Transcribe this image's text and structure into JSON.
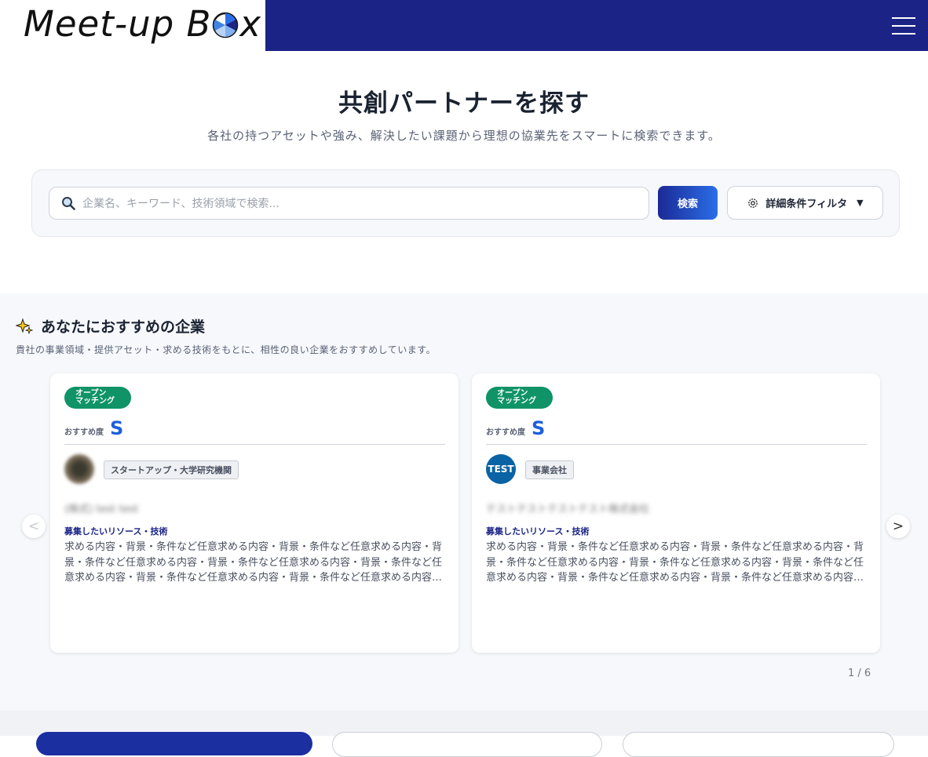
{
  "header": {
    "logo_text_main": "Meet-up B",
    "logo_text_tail": "x",
    "menu_icon": "hamburger-icon"
  },
  "hero": {
    "title": "共創パートナーを探す",
    "subtitle": "各社の持つアセットや強み、解決したい課題から理想の協業先をスマートに検索できます。"
  },
  "search": {
    "placeholder": "企業名、キーワード、技術領域で検索...",
    "value": "",
    "button_label": "検索",
    "filter_label": "詳細条件フィルタ",
    "filter_caret": "▼"
  },
  "recommend": {
    "title": "あなたにおすすめの企業",
    "subtitle": "貴社の事業領域・提供アセット・求める技術をもとに、相性の良い企業をおすすめしています。",
    "prev_arrow": "<",
    "next_arrow": ">",
    "pager": "1 / 6",
    "cards": [
      {
        "badge_line1": "オープン",
        "badge_line2": "マッチング",
        "score_label": "おすすめ度",
        "score": "S",
        "type_tag": "スタートアップ・大学研究機関",
        "company_name": "(株式) test test",
        "resource_label": "募集したいリソース・技術",
        "description": "求める内容・背景・条件など任意求める内容・背景・条件など任意求める内容・背景・条件など任意求める内容・背景・条件など任意求める内容・背景・条件など任意求める内容・背景・条件など任意求める内容・背景・条件など任意求める内容・背景・条件など任意求める内容・背景・条件など任意"
      },
      {
        "badge_line1": "オープン",
        "badge_line2": "マッチング",
        "score_label": "おすすめ度",
        "score": "S",
        "avatar_text": "TEST",
        "type_tag": "事業会社",
        "company_name": "テストテストテストテスト株式会社",
        "resource_label": "募集したいリソース・技術",
        "description": "求める内容・背景・条件など任意求める内容・背景・条件など任意求める内容・背景・条件など任意求める内容・背景・条件など任意求める内容・背景・条件など任意求める内容・背景・条件など任意求める内容・背景・条件など任意求める内容・背景・条件など任意求める内容・背景・条件など任意"
      }
    ]
  },
  "colors": {
    "header_bg": "#1b2486",
    "accent_blue": "#1e5fdc",
    "badge_green": "#0f9367"
  }
}
